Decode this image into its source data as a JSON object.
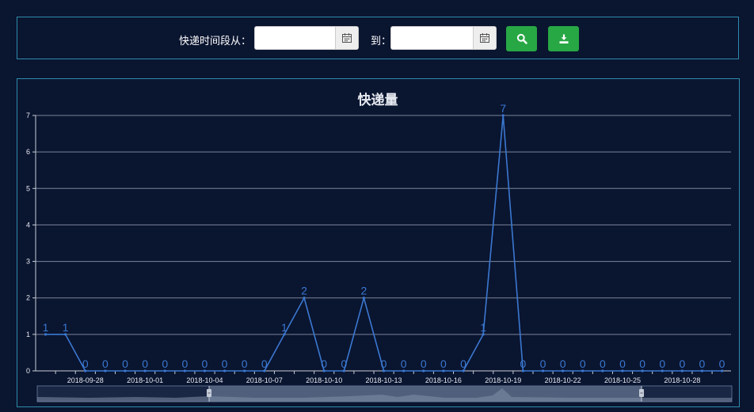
{
  "filter": {
    "from_label": "快递时间段从：",
    "to_label": "到：",
    "from_value": "",
    "to_value": "",
    "search_icon": "search-icon",
    "export_icon": "download-icon",
    "button_color": "#28a745"
  },
  "chart_data": {
    "type": "line",
    "title": "快递量",
    "xlabel": "",
    "ylabel": "",
    "ylim": [
      0,
      7
    ],
    "yticks": [
      0,
      1,
      2,
      3,
      4,
      5,
      6,
      7
    ],
    "grid": true,
    "line_color": "#3b78d0",
    "categories": [
      "2018-09-26",
      "2018-09-27",
      "2018-09-28",
      "2018-09-29",
      "2018-09-30",
      "2018-10-01",
      "2018-10-02",
      "2018-10-03",
      "2018-10-04",
      "2018-10-05",
      "2018-10-06",
      "2018-10-07",
      "2018-10-08",
      "2018-10-09",
      "2018-10-10",
      "2018-10-11",
      "2018-10-12",
      "2018-10-13",
      "2018-10-14",
      "2018-10-15",
      "2018-10-16",
      "2018-10-17",
      "2018-10-18",
      "2018-10-19",
      "2018-10-20",
      "2018-10-21",
      "2018-10-22",
      "2018-10-23",
      "2018-10-24",
      "2018-10-25",
      "2018-10-26",
      "2018-10-27",
      "2018-10-28",
      "2018-10-29",
      "2018-10-30"
    ],
    "tick_labels": [
      "2018-09-28",
      "2018-10-01",
      "2018-10-04",
      "2018-10-07",
      "2018-10-10",
      "2018-10-13",
      "2018-10-16",
      "2018-10-19",
      "2018-10-22",
      "2018-10-25",
      "2018-10-28"
    ],
    "series": [
      {
        "values": [
          1,
          1,
          0,
          0,
          0,
          0,
          0,
          0,
          0,
          0,
          0,
          0,
          1,
          2,
          0,
          0,
          2,
          0,
          0,
          0,
          0,
          0,
          1,
          7,
          0,
          0,
          0,
          0,
          0,
          0,
          0,
          0,
          0,
          0,
          0
        ]
      }
    ]
  }
}
